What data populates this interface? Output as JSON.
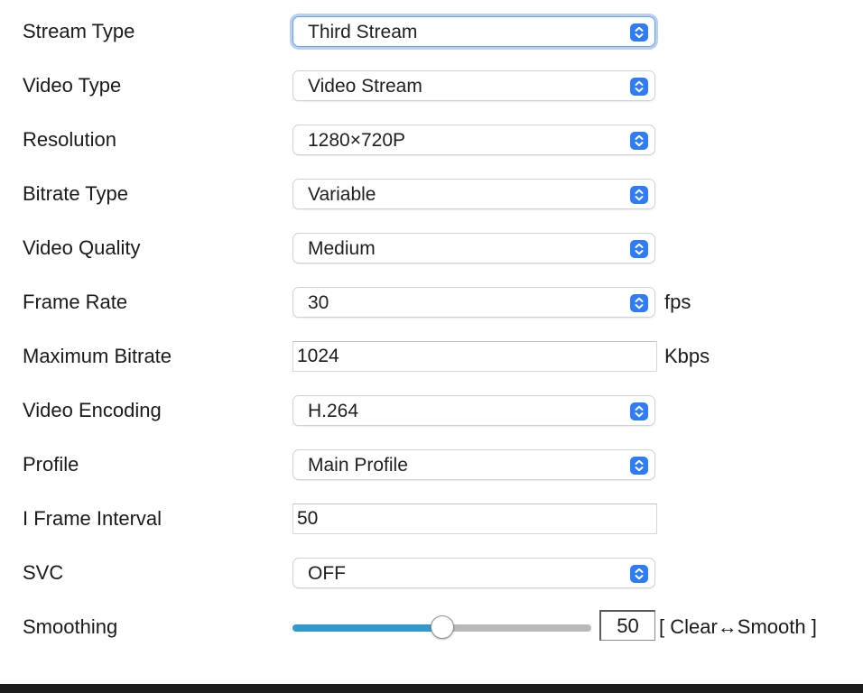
{
  "rows": [
    {
      "label": "Stream Type",
      "value": "Third Stream"
    },
    {
      "label": "Video Type",
      "value": "Video Stream"
    },
    {
      "label": "Resolution",
      "value": "1280×720P"
    },
    {
      "label": "Bitrate Type",
      "value": "Variable"
    },
    {
      "label": "Video Quality",
      "value": "Medium"
    },
    {
      "label": "Frame Rate",
      "value": "30",
      "unit": "fps"
    },
    {
      "label": "Maximum Bitrate",
      "value": "1024",
      "unit": "Kbps"
    },
    {
      "label": "Video Encoding",
      "value": "H.264"
    },
    {
      "label": "Profile",
      "value": "Main Profile"
    },
    {
      "label": "I Frame Interval",
      "value": "50"
    },
    {
      "label": "SVC",
      "value": "OFF"
    },
    {
      "label": "Smoothing",
      "value": "50",
      "hint": "[ Clear↔Smooth ]"
    }
  ],
  "smoothing": {
    "level_percent": 50,
    "min": 0,
    "max": 100
  },
  "colors": {
    "select_arrow": "#2f7cf6",
    "slider_fill": "#3399cc",
    "slider_track": "#b9b9b9",
    "focus_ring": "#6096e1"
  },
  "icons": {
    "select_arrow": "chevron-up-down-icon"
  }
}
